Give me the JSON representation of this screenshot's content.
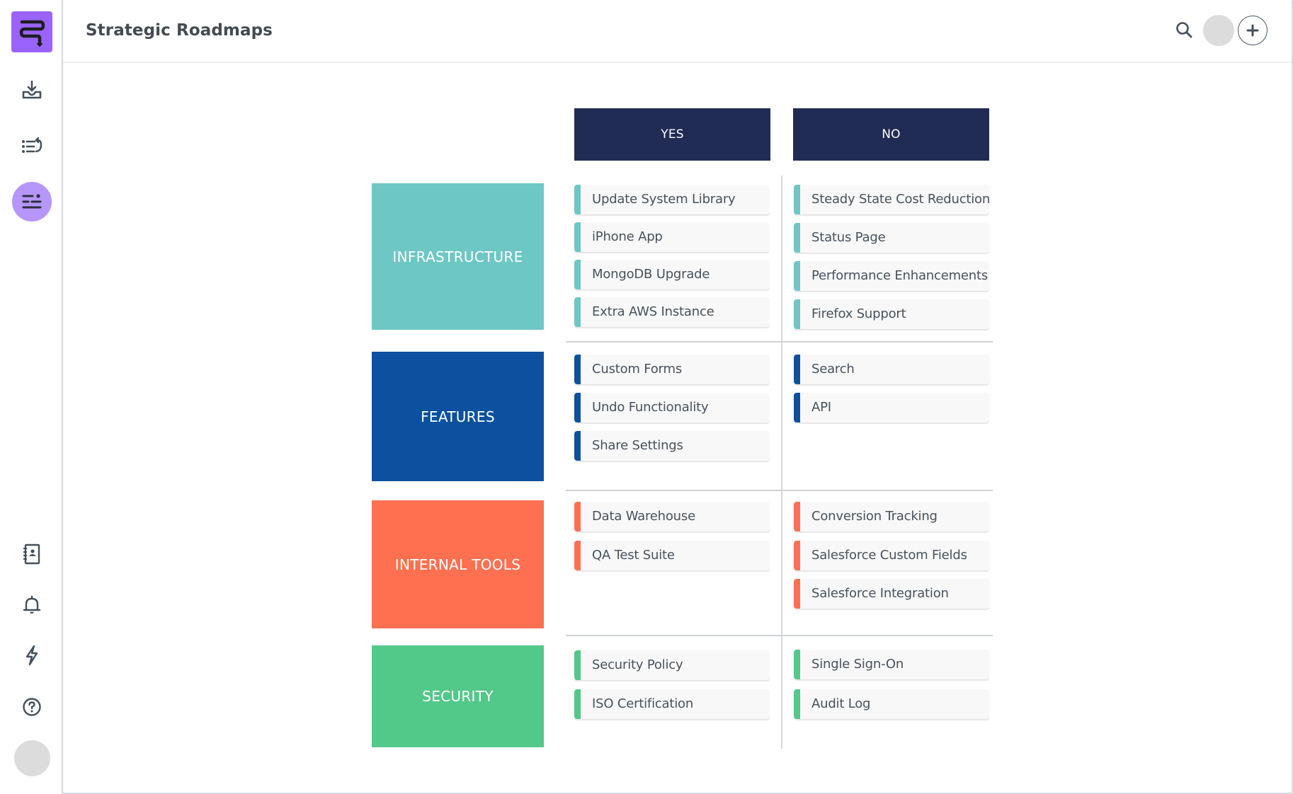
{
  "app": {
    "title": "Strategic Roadmaps"
  },
  "sidebar": {
    "logo": "roadmap-logo",
    "top_items": [
      {
        "icon": "inbox-download-icon",
        "label": "Import"
      },
      {
        "icon": "list-return-icon",
        "label": "Lists"
      },
      {
        "icon": "roadmap-sliders-icon",
        "label": "Roadmaps",
        "active": true
      }
    ],
    "bottom_items": [
      {
        "icon": "contacts-book-icon",
        "label": "Contacts"
      },
      {
        "icon": "bell-icon",
        "label": "Notifications"
      },
      {
        "icon": "lightning-icon",
        "label": "Integrations"
      },
      {
        "icon": "help-circle-icon",
        "label": "Help"
      }
    ]
  },
  "header": {
    "search_icon": "search-icon",
    "add_icon": "plus-icon"
  },
  "matrix": {
    "columns": [
      "YES",
      "NO"
    ],
    "rows": [
      {
        "category": "INFRASTRUCTURE",
        "color": "#6dc7c5",
        "yes": [
          "Update System Library",
          "iPhone App",
          "MongoDB Upgrade",
          "Extra AWS Instance"
        ],
        "no": [
          "Steady State Cost Reductions",
          "Status Page",
          "Performance Enhancements",
          "Firefox Support"
        ]
      },
      {
        "category": "FEATURES",
        "color": "#0b519f",
        "yes": [
          "Custom Forms",
          "Undo Functionality",
          "Share Settings"
        ],
        "no": [
          "Search",
          "API"
        ]
      },
      {
        "category": "INTERNAL TOOLS",
        "color": "#ff7050",
        "yes": [
          "Data Warehouse",
          "QA Test Suite"
        ],
        "no": [
          "Conversion Tracking",
          "Salesforce Custom Fields",
          "Salesforce Integration"
        ]
      },
      {
        "category": "SECURITY",
        "color": "#52c889",
        "yes": [
          "Security Policy",
          "ISO Certification"
        ],
        "no": [
          "Single Sign-On",
          "Audit Log"
        ]
      }
    ]
  },
  "colors": {
    "header_bg": "#212c55",
    "accent_purple": "#9a63fb",
    "active_nav": "#b696fb"
  }
}
